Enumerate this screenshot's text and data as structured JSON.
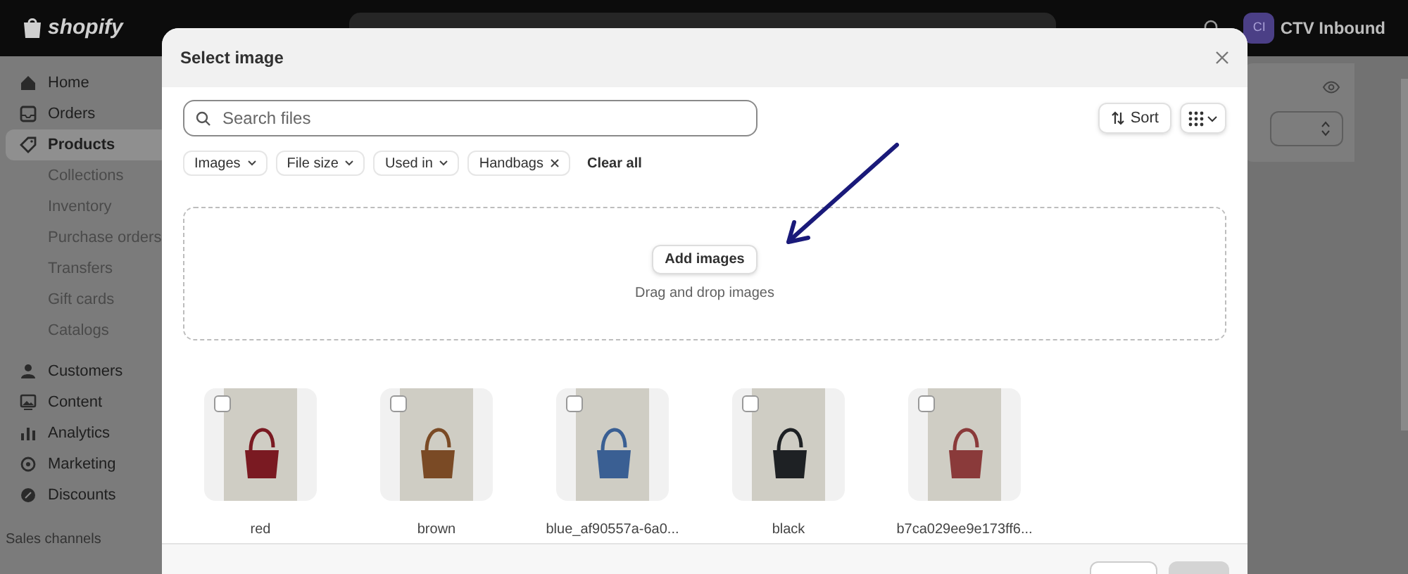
{
  "topbar": {
    "brand": "shopify",
    "account": {
      "initials": "CI",
      "name": "CTV Inbound"
    }
  },
  "sidebar": {
    "items": [
      {
        "label": "Home",
        "kind": "main",
        "selected": false
      },
      {
        "label": "Orders",
        "kind": "main",
        "selected": false
      },
      {
        "label": "Products",
        "kind": "main",
        "selected": true
      },
      {
        "label": "Collections",
        "kind": "sub",
        "selected": false
      },
      {
        "label": "Inventory",
        "kind": "sub",
        "selected": false
      },
      {
        "label": "Purchase orders",
        "kind": "sub",
        "selected": false
      },
      {
        "label": "Transfers",
        "kind": "sub",
        "selected": false
      },
      {
        "label": "Gift cards",
        "kind": "sub",
        "selected": false
      },
      {
        "label": "Catalogs",
        "kind": "sub",
        "selected": false
      },
      {
        "label": "Customers",
        "kind": "main",
        "selected": false
      },
      {
        "label": "Content",
        "kind": "main",
        "selected": false
      },
      {
        "label": "Analytics",
        "kind": "main",
        "selected": false
      },
      {
        "label": "Marketing",
        "kind": "main",
        "selected": false
      },
      {
        "label": "Discounts",
        "kind": "main",
        "selected": false
      }
    ],
    "section": "Sales channels"
  },
  "modal": {
    "title": "Select image",
    "search": {
      "placeholder": "Search files"
    },
    "sort": "Sort",
    "filters": [
      {
        "label": "Images",
        "kind": "dropdown"
      },
      {
        "label": "File size",
        "kind": "dropdown"
      },
      {
        "label": "Used in",
        "kind": "dropdown"
      },
      {
        "label": "Handbags",
        "kind": "applied"
      }
    ],
    "clear_all": "Clear all",
    "dropzone": {
      "button": "Add images",
      "hint": "Drag and drop images"
    },
    "files": [
      {
        "name": "red",
        "checked": false,
        "color": "#7a1a22"
      },
      {
        "name": "brown",
        "checked": false,
        "color": "#7a4a25"
      },
      {
        "name": "blue_af90557a-6a0...",
        "checked": false,
        "color": "#3a5f93"
      },
      {
        "name": "black",
        "checked": false,
        "color": "#1e2124"
      },
      {
        "name": "b7ca029ee9e173ff6...",
        "checked": false,
        "color": "#8a3a3a"
      }
    ]
  }
}
